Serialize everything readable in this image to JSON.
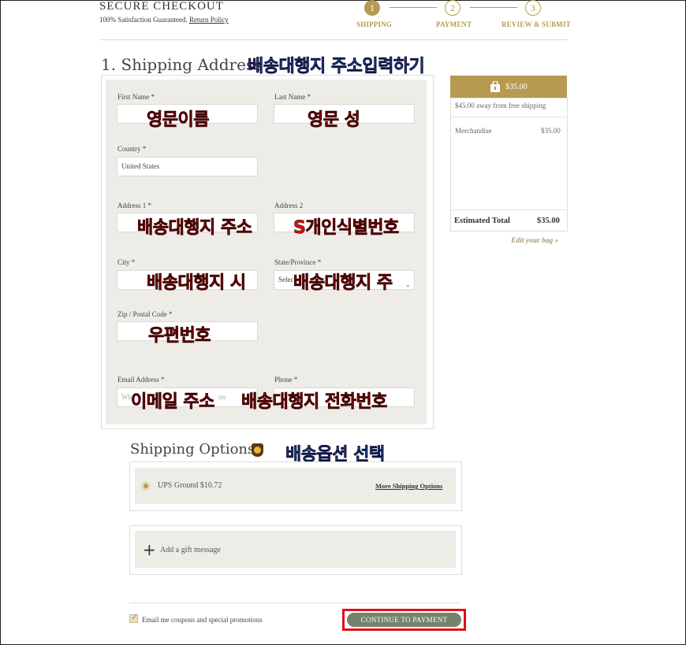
{
  "header": {
    "title": "SECURE CHECKOUT",
    "subtitle": "100% Satisfaction Guaranteed.",
    "return_policy": "Return Policy",
    "steps": [
      {
        "num": "1",
        "label": "SHIPPING",
        "active": true
      },
      {
        "num": "2",
        "label": "PAYMENT",
        "active": false
      },
      {
        "num": "3",
        "label": "REVIEW & SUBMIT",
        "active": false
      }
    ]
  },
  "shipping": {
    "title": "1. Shipping Address",
    "annotation": "배송대행지 주소입력하기",
    "fields": {
      "first_name": {
        "label": "First Name *",
        "value": "",
        "annotation": "영문이름"
      },
      "last_name": {
        "label": "Last Name *",
        "value": "",
        "annotation": "영문 성"
      },
      "country": {
        "label": "Country *",
        "value": "United States"
      },
      "address1": {
        "label": "Address 1 *",
        "value": "",
        "annotation": "배송대행지 주소"
      },
      "address2": {
        "label": "Address 2",
        "value": "",
        "annotation": "S개인식별번호"
      },
      "city": {
        "label": "City *",
        "value": "",
        "annotation": "배송대행지 시"
      },
      "state": {
        "label": "State/Province *",
        "value": "Selec",
        "annotation": "배송대행지 주"
      },
      "zip": {
        "label": "Zip / Postal Code *",
        "value": "",
        "annotation": "우편번호"
      },
      "email": {
        "label": "Email Address *",
        "placeholder": "Wh",
        "placeholder_tail": "on",
        "annotation": "이메일 주소"
      },
      "phone": {
        "label": "Phone *",
        "value": "",
        "annotation": "배송대행지 전화번호"
      }
    }
  },
  "cart": {
    "total_badge": "$35.00",
    "free_shipping_note": "$45.00 away from free shipping",
    "merch_label": "Merchandise",
    "merch_value": "$35.00",
    "estimated_label": "Estimated Total",
    "estimated_value": "$35.00",
    "edit_link": "Edit your bag »"
  },
  "options": {
    "title": "Shipping Options",
    "annotation": "배송옵션 선택",
    "ups_option": "UPS Ground $10.72",
    "more_options": "More Shipping Options",
    "gift_message": "Add a gift message"
  },
  "footer": {
    "email_opt_in": "Email me coupons and special promotions",
    "continue": "CONTINUE TO PAYMENT"
  },
  "colors": {
    "accent": "#b79a4f",
    "panel": "#edece6",
    "button": "#76826a",
    "highlight": "#e0101a",
    "anno_blue": "#2aa6d6",
    "anno_red": "#d8120f"
  }
}
